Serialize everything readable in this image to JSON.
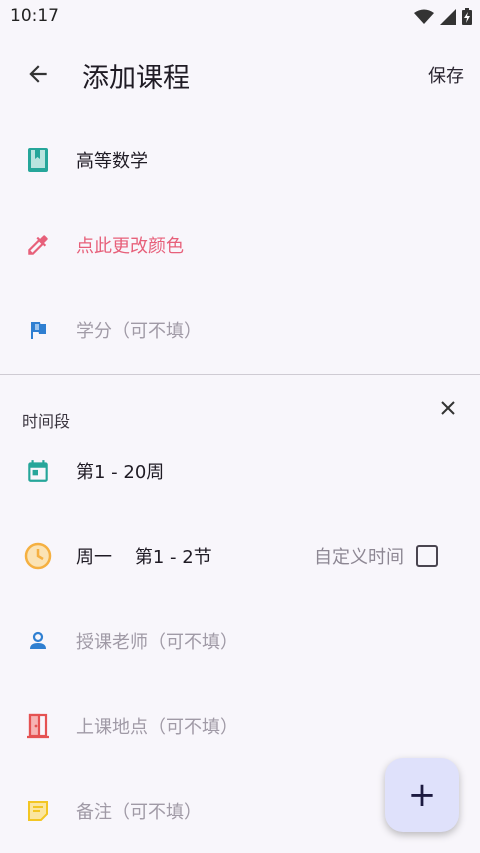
{
  "status_bar": {
    "time": "10:17"
  },
  "app_bar": {
    "title": "添加课程",
    "save_label": "保存"
  },
  "course": {
    "name": "高等数学",
    "color_action": "点此更改颜色",
    "credit_placeholder": "学分（可不填）"
  },
  "time_segment": {
    "label": "时间段",
    "weeks": "第1 - 20周",
    "day_period": "周一    第1 - 2节",
    "custom_time_label": "自定义时间",
    "teacher_placeholder": "授课老师（可不填）",
    "location_placeholder": "上课地点（可不填）",
    "note_placeholder": "备注（可不填）"
  },
  "fab": {
    "label": "+"
  },
  "colors": {
    "book_icon": "#26a69a",
    "picker_icon": "#e7607a",
    "flag_icon": "#2f7fd1",
    "calendar_icon": "#26a69a",
    "clock_icon": "#f5b041",
    "person_icon": "#2f7fd1",
    "door_icon": "#e55252",
    "note_icon": "#f3c623",
    "fab_bg": "#dfe1fb"
  }
}
